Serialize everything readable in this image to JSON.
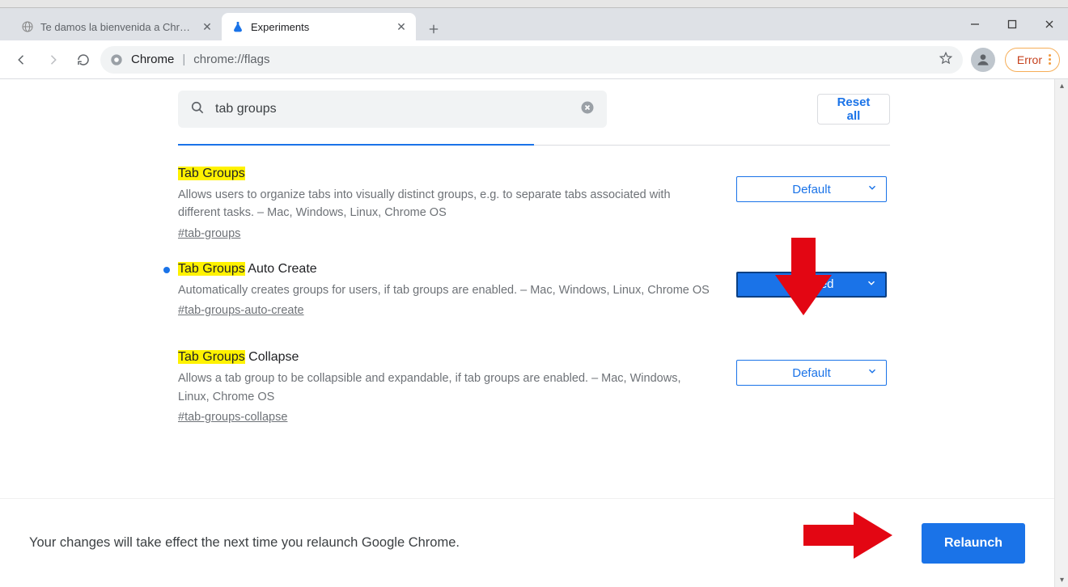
{
  "tabs": {
    "inactive": {
      "title": "Te damos la bienvenida a Chrome"
    },
    "active": {
      "title": "Experiments"
    }
  },
  "omnibox": {
    "host": "Chrome",
    "sep": " | ",
    "path": "chrome://flags"
  },
  "error_pill": "Error",
  "search": {
    "value": "tab groups"
  },
  "reset_all": "Reset all",
  "flags": [
    {
      "title_hl": "Tab Groups",
      "title_rest": "",
      "desc": "Allows users to organize tabs into visually distinct groups, e.g. to separate tabs associated with different tasks. – Mac, Windows, Linux, Chrome OS",
      "anchor": "#tab-groups",
      "select": "Default",
      "select_state": "default",
      "dot": false
    },
    {
      "title_hl": "Tab Groups",
      "title_rest": " Auto Create",
      "desc": "Automatically creates groups for users, if tab groups are enabled. – Mac, Windows, Linux, Chrome OS",
      "anchor": "#tab-groups-auto-create",
      "select": "Enabled",
      "select_state": "enabled",
      "dot": true
    },
    {
      "title_hl": "Tab Groups",
      "title_rest": " Collapse",
      "desc": "Allows a tab group to be collapsible and expandable, if tab groups are enabled. – Mac, Windows, Linux, Chrome OS",
      "anchor": "#tab-groups-collapse",
      "select": "Default",
      "select_state": "default",
      "dot": false
    }
  ],
  "footer": {
    "msg": "Your changes will take effect the next time you relaunch Google Chrome.",
    "relaunch": "Relaunch"
  }
}
